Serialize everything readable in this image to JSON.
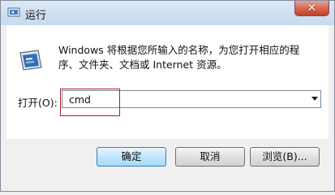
{
  "window": {
    "title": "运行"
  },
  "dialog": {
    "description": "Windows 将根据您所输入的名称，为您打开相应的程序、文件夹、文档或 Internet 资源。",
    "open_label": "打开(O):",
    "open_value": "cmd"
  },
  "buttons": {
    "ok": "确定",
    "cancel": "取消",
    "browse": "浏览(B)..."
  },
  "icons": {
    "app": "run-icon",
    "close": "close-icon",
    "dropdown": "chevron-down-icon"
  }
}
